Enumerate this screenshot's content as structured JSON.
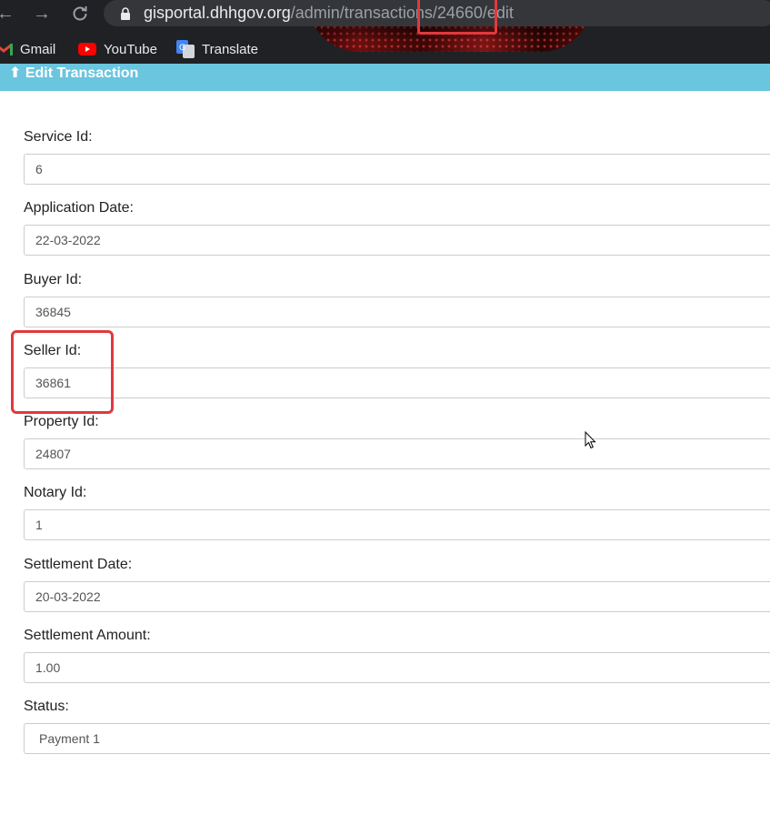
{
  "browser": {
    "url_host": "gisportal.dhhgov.org",
    "url_path": "/admin/transactions/24660/edit",
    "bookmarks": [
      {
        "label": "Gmail",
        "icon": "gmail-icon"
      },
      {
        "label": "YouTube",
        "icon": "youtube-icon"
      },
      {
        "label": "Translate",
        "icon": "translate-icon"
      }
    ]
  },
  "header": {
    "title": "Edit Transaction",
    "icon": "pin-icon"
  },
  "form": {
    "service_id": {
      "label": "Service Id:",
      "value": "6"
    },
    "application_date": {
      "label": "Application Date:",
      "value": "22-03-2022"
    },
    "buyer_id": {
      "label": "Buyer Id:",
      "value": "36845"
    },
    "seller_id": {
      "label": "Seller Id:",
      "value": "36861"
    },
    "property_id": {
      "label": "Property Id:",
      "value": "24807"
    },
    "notary_id": {
      "label": "Notary Id:",
      "value": "1"
    },
    "settlement_date": {
      "label": "Settlement Date:",
      "value": "20-03-2022"
    },
    "settlement_amount": {
      "label": "Settlement Amount:",
      "value": "1.00"
    },
    "status": {
      "label": "Status:",
      "value": "Payment 1"
    }
  },
  "colors": {
    "header_bar": "#6ac5df",
    "annotation": "#e0393e",
    "browser_chrome": "#202124"
  }
}
